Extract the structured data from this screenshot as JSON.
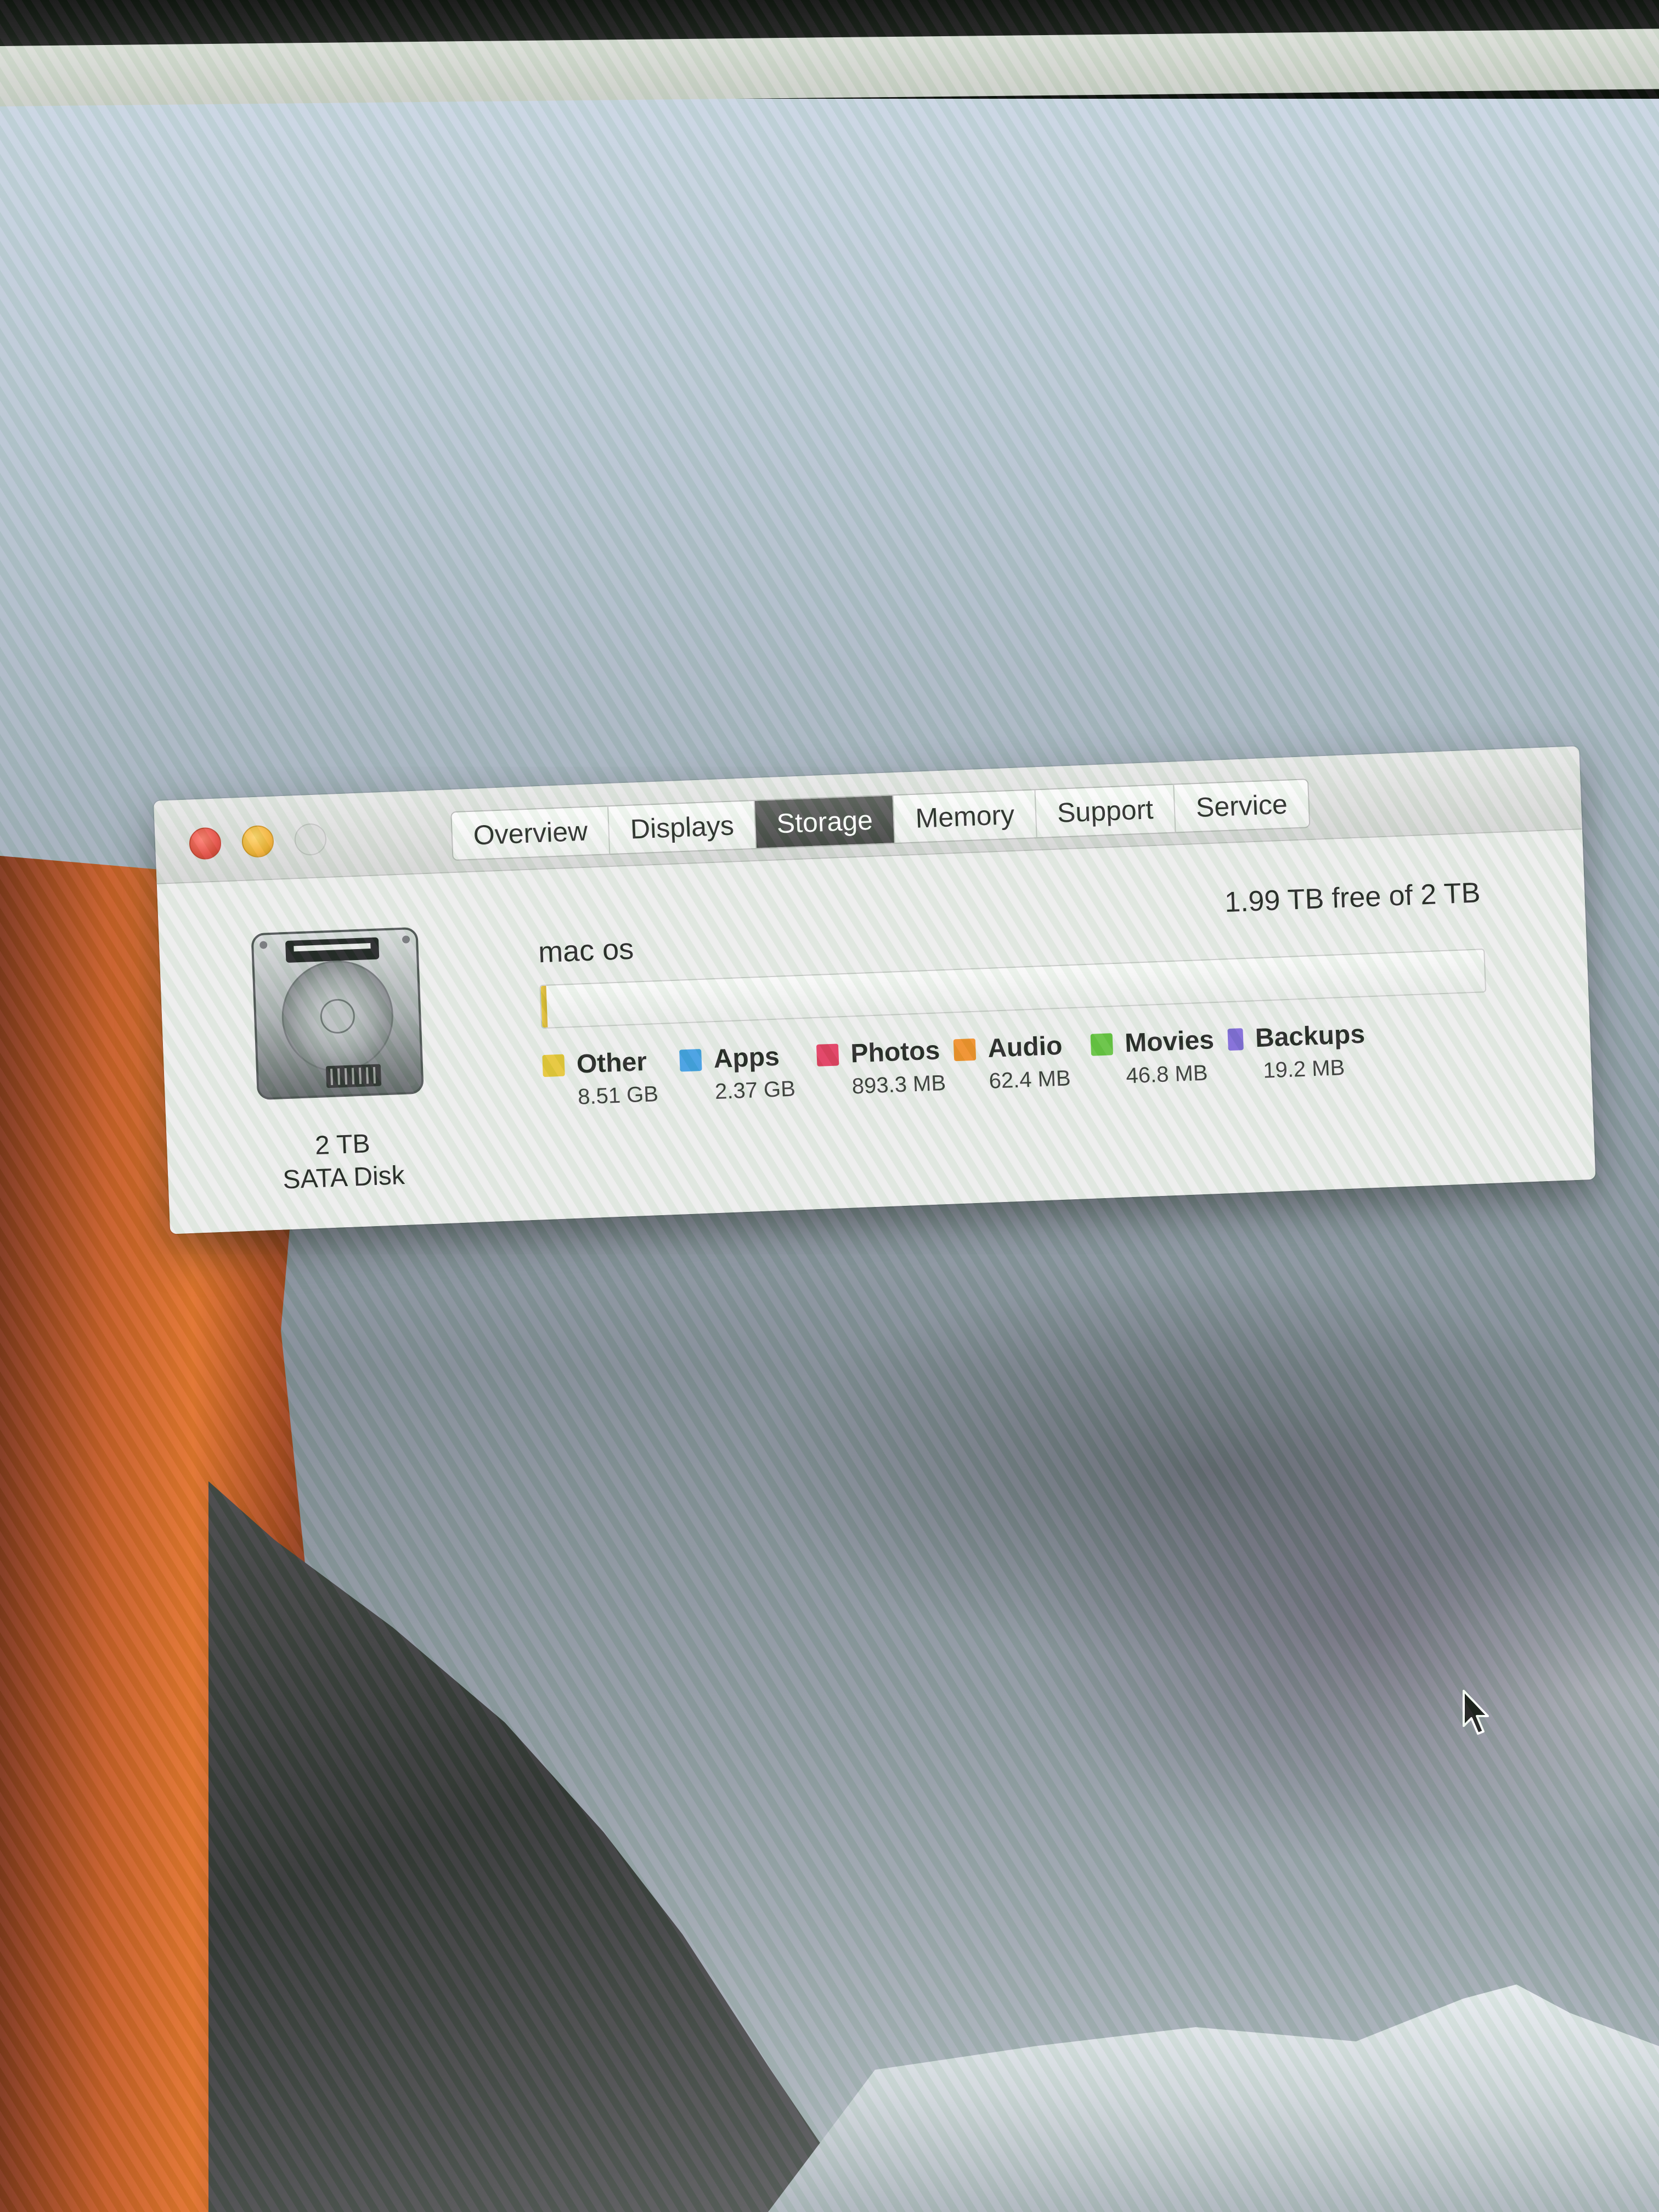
{
  "window": {
    "tabs": [
      {
        "label": "Overview",
        "active": false
      },
      {
        "label": "Displays",
        "active": false
      },
      {
        "label": "Storage",
        "active": true
      },
      {
        "label": "Memory",
        "active": false
      },
      {
        "label": "Support",
        "active": false
      },
      {
        "label": "Service",
        "active": false
      }
    ],
    "traffic_lights": {
      "close": "#e0443a",
      "minimize": "#f0ac2e",
      "zoom": "#d8d8d8"
    }
  },
  "storage": {
    "disk": {
      "icon": "hard-disk-icon",
      "size_label": "2 TB",
      "type_label": "SATA Disk"
    },
    "volume_name": "mac os",
    "free_space_label": "1.99 TB free of 2 TB",
    "used_fraction": 0.006,
    "categories": [
      {
        "name": "Other",
        "size": "8.51 GB",
        "color": "#e5c330"
      },
      {
        "name": "Apps",
        "size": "2.37 GB",
        "color": "#3b9ae1"
      },
      {
        "name": "Photos",
        "size": "893.3 MB",
        "color": "#e0345a"
      },
      {
        "name": "Audio",
        "size": "62.4 MB",
        "color": "#ef8a22"
      },
      {
        "name": "Movies",
        "size": "46.8 MB",
        "color": "#5fbf3a"
      },
      {
        "name": "Backups",
        "size": "19.2 MB",
        "color": "#7b63d6"
      }
    ]
  },
  "desktop": {
    "cursor_icon": "mouse-pointer-icon"
  }
}
